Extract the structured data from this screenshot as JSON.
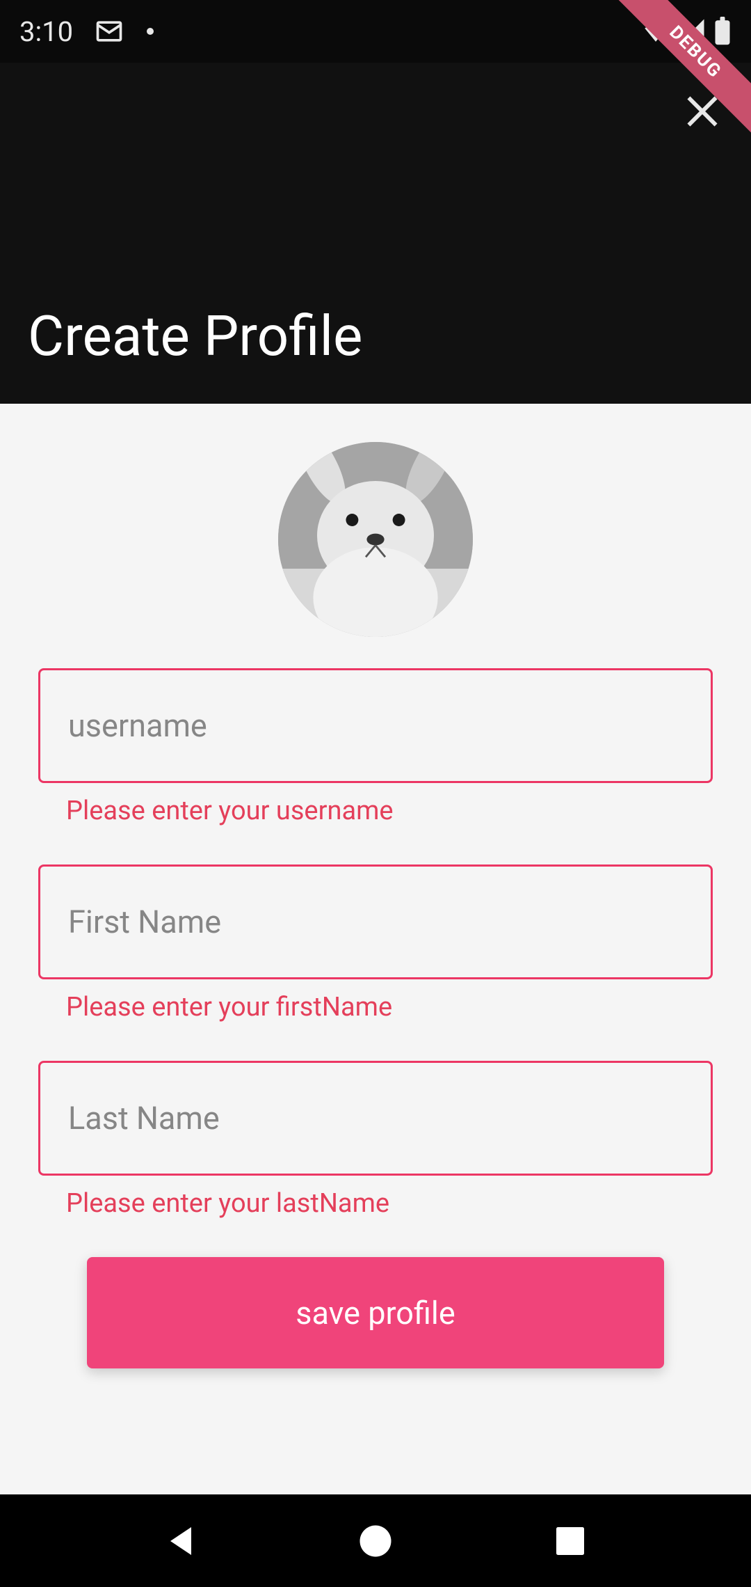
{
  "status": {
    "clock": "3:10"
  },
  "header": {
    "title": "Create Profile"
  },
  "form": {
    "username": {
      "placeholder": "username",
      "value": "",
      "error": "Please enter your username"
    },
    "firstname": {
      "placeholder": "First Name",
      "value": "",
      "error": "Please enter your firstName"
    },
    "lastname": {
      "placeholder": "Last Name",
      "value": "",
      "error": "Please enter your lastName"
    },
    "save_label": "save profile"
  },
  "ribbon": {
    "label": "DEBUG"
  },
  "colors": {
    "error": "#e43f5a",
    "accent": "#f0447a",
    "border": "#ec3664"
  }
}
